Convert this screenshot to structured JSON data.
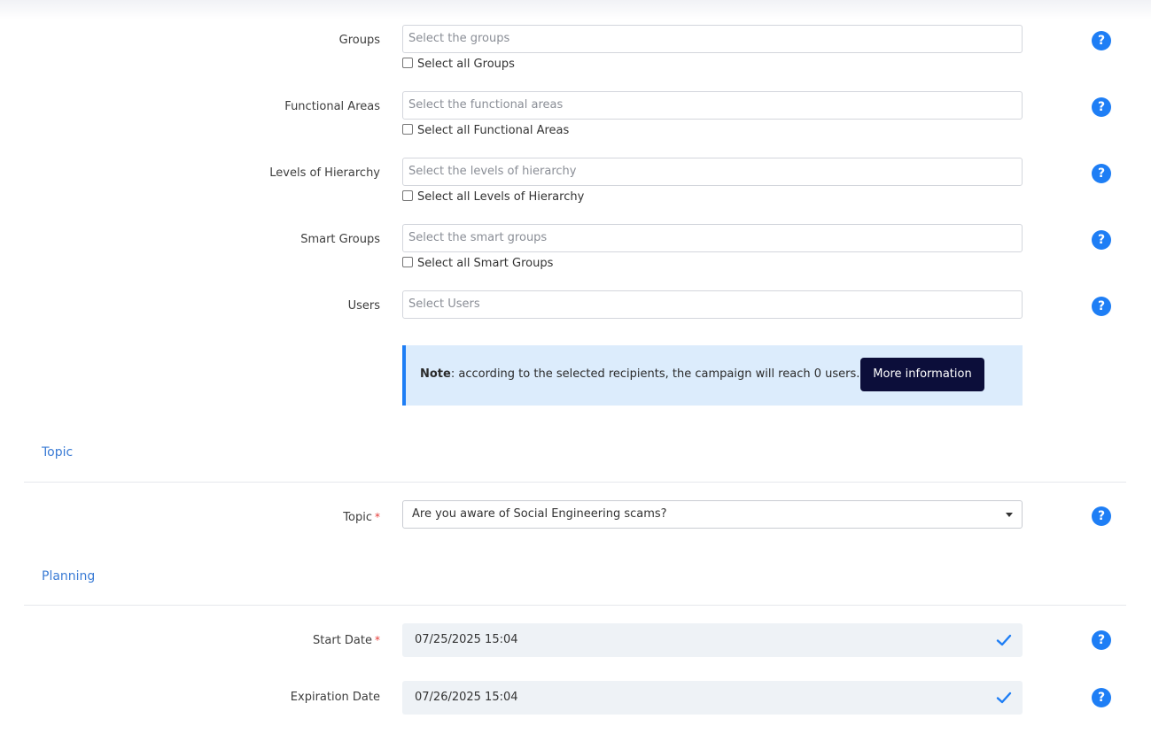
{
  "recipients": {
    "groups": {
      "label": "Groups",
      "placeholder": "Select the groups",
      "select_all": "Select all Groups"
    },
    "functional_areas": {
      "label": "Functional Areas",
      "placeholder": "Select the functional areas",
      "select_all": "Select all Functional Areas"
    },
    "levels": {
      "label": "Levels of Hierarchy",
      "placeholder": "Select the levels of hierarchy",
      "select_all": "Select all Levels of Hierarchy"
    },
    "smart_groups": {
      "label": "Smart Groups",
      "placeholder": "Select the smart groups",
      "select_all": "Select all Smart Groups"
    },
    "users": {
      "label": "Users",
      "placeholder": "Select Users"
    }
  },
  "note": {
    "bold": "Note",
    "text": ": according to the selected recipients, the campaign will reach 0 users.",
    "button": "More information"
  },
  "topic_section": {
    "title": "Topic",
    "label": "Topic",
    "required_mark": "*",
    "selected_value": "Are you aware of Social Engineering scams?"
  },
  "planning_section": {
    "title": "Planning",
    "start_date": {
      "label": "Start Date",
      "required_mark": "*",
      "value": "07/25/2025 15:04"
    },
    "expiration_date": {
      "label": "Expiration Date",
      "value": "07/26/2025 15:04"
    }
  },
  "help_glyph": "?",
  "colors": {
    "accent": "#1e7ef5",
    "note_bg": "#dcecfc",
    "button_bg": "#0c0e3a",
    "section_title": "#3a7bd5"
  },
  "icons": {
    "help": "question-circle-icon",
    "valid": "check-icon",
    "dropdown": "caret-down-icon"
  }
}
